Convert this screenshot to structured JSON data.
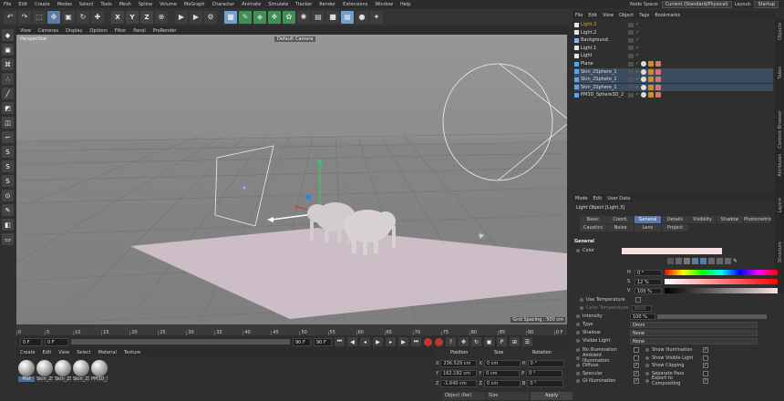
{
  "menubar": {
    "items": [
      "File",
      "Edit",
      "Create",
      "Modes",
      "Select",
      "Tools",
      "Mesh",
      "Spline",
      "Volume",
      "MoGraph",
      "Character",
      "Animate",
      "Simulate",
      "Tracker",
      "Render",
      "Extensions",
      "Window",
      "Help"
    ],
    "node_space_label": "Node Space:",
    "node_space_value": "Current (Standard/Physical)",
    "layout_label": "Layout:",
    "layout_value": "Startup"
  },
  "toolbar": {
    "x": "X",
    "y": "Y",
    "z": "Z"
  },
  "viewport": {
    "menu": [
      "View",
      "Cameras",
      "Display",
      "Options",
      "Filter",
      "Panel",
      "ProRender"
    ],
    "label": "Perspective",
    "camera": "Default Camera",
    "grid_spacing": "Grid Spacing : 500 cm"
  },
  "timeline": {
    "ticks": [
      "0",
      "5",
      "10",
      "15",
      "20",
      "25",
      "30",
      "35",
      "40",
      "45",
      "50",
      "55",
      "60",
      "65",
      "70",
      "75",
      "80",
      "85",
      "90"
    ],
    "end_marker": "0 F"
  },
  "transport": {
    "start": "0 F",
    "current": "0 F",
    "max": "90 F",
    "end": "90 F"
  },
  "materials": {
    "menu": [
      "Create",
      "Edit",
      "View",
      "Select",
      "Material",
      "Texture"
    ],
    "items": [
      {
        "name": "Mat"
      },
      {
        "name": "Skin_2Sp"
      },
      {
        "name": "Skin_2Sp"
      },
      {
        "name": "Skin_2Sp"
      },
      {
        "name": "PM3D_S"
      }
    ]
  },
  "coords": {
    "position_header": "Position",
    "size_header": "Size",
    "rotation_header": "Rotation",
    "rows": [
      {
        "axis": "X",
        "pos": "236.529 cm",
        "saxis": "X",
        "size": "0 cm",
        "raxis": "H",
        "rot": "0 °"
      },
      {
        "axis": "Y",
        "pos": "162.192 cm",
        "saxis": "Y",
        "size": "0 cm",
        "raxis": "P",
        "rot": "0 °"
      },
      {
        "axis": "Z",
        "pos": "-1.640 cm",
        "saxis": "Z",
        "size": "0 cm",
        "raxis": "B",
        "rot": "0 °"
      }
    ],
    "mode": "Object (Rel)",
    "size_mode": "Size",
    "apply": "Apply"
  },
  "objects": {
    "menu": [
      "File",
      "Edit",
      "View",
      "Object",
      "Tags",
      "Bookmarks"
    ],
    "rows": [
      {
        "name": "Light.3",
        "active": true,
        "selected": false,
        "icon": "#e8e8e8"
      },
      {
        "name": "Light.2",
        "active": false,
        "selected": false,
        "icon": "#e8e8e8"
      },
      {
        "name": "Background",
        "active": false,
        "selected": false,
        "icon": "#8cb4e0"
      },
      {
        "name": "Light.1",
        "active": false,
        "selected": false,
        "icon": "#e8e8e8"
      },
      {
        "name": "Light",
        "active": false,
        "selected": false,
        "icon": "#e8e8e8"
      },
      {
        "name": "Plane",
        "active": false,
        "selected": false,
        "icon": "#5fa3e0"
      },
      {
        "name": "Skin_2Sphere_1",
        "active": false,
        "selected": true,
        "icon": "#5fa3e0"
      },
      {
        "name": "Skin_2Sphere_1",
        "active": false,
        "selected": true,
        "icon": "#5fa3e0"
      },
      {
        "name": "Skin_2Sphere_1",
        "active": false,
        "selected": true,
        "icon": "#5fa3e0"
      },
      {
        "name": "PM3D_Sphere3D_2",
        "active": false,
        "selected": false,
        "icon": "#5fa3e0"
      }
    ]
  },
  "sidetabs": [
    "Objects",
    "Takes",
    "Content Browser",
    "Attributes",
    "Layers",
    "Structure"
  ],
  "attributes": {
    "menu": [
      "Mode",
      "Edit",
      "User Data"
    ],
    "title": "Light Object [Light.3]",
    "tabs_row1": [
      "Basic",
      "Coord.",
      "General",
      "Details",
      "Visibility",
      "Shadow",
      "Photometric"
    ],
    "tabs_row2": [
      "Caustics",
      "Noise",
      "Lens",
      "Project"
    ],
    "active_tab": "General",
    "section": "General",
    "color_label": "Color",
    "h_label": "H",
    "h_value": "0 °",
    "s_label": "S",
    "s_value": "12 %",
    "v_label": "V",
    "v_value": "100 %",
    "use_temp": "Use Temperature",
    "color_temp": "Color Temperature",
    "color_temp_val": "6500",
    "intensity_label": "Intensity",
    "intensity_value": "100 %",
    "type_label": "Type",
    "type_value": "Omni",
    "shadow_label": "Shadow",
    "shadow_value": "None",
    "visible_light_label": "Visible Light",
    "visible_light_value": "None",
    "checks_left": [
      {
        "label": "No Illumination",
        "checked": false
      },
      {
        "label": "Ambient Illumination",
        "checked": false
      },
      {
        "label": "Diffuse",
        "checked": true
      },
      {
        "label": "Specular",
        "checked": true
      },
      {
        "label": "GI Illumination",
        "checked": true
      }
    ],
    "checks_right": [
      {
        "label": "Show Illumination",
        "checked": true
      },
      {
        "label": "Show Visible Light",
        "checked": false
      },
      {
        "label": "Show Clipping",
        "checked": true
      },
      {
        "label": "Separate Pass",
        "checked": false
      },
      {
        "label": "Export to Compositing",
        "checked": true
      }
    ]
  }
}
